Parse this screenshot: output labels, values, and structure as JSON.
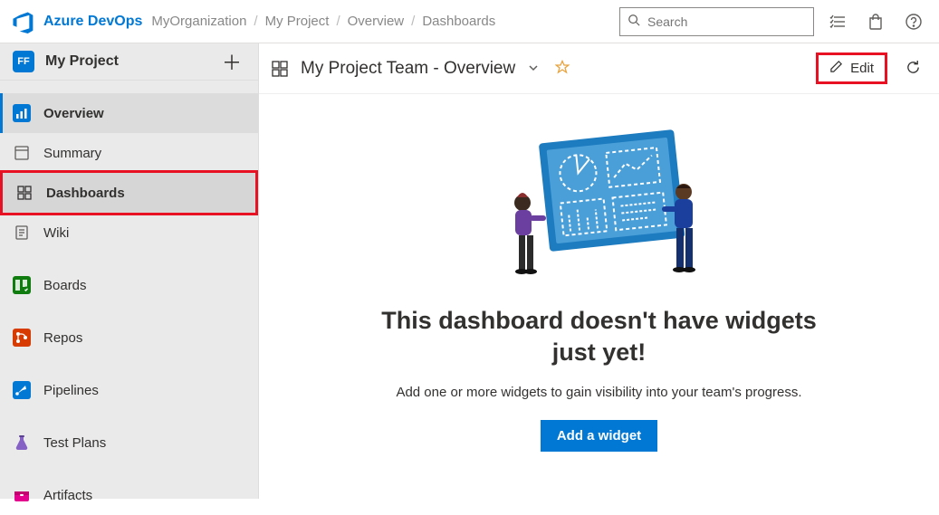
{
  "header": {
    "brand": "Azure DevOps",
    "breadcrumb": [
      "MyOrganization",
      "My Project",
      "Overview",
      "Dashboards"
    ],
    "search_placeholder": "Search"
  },
  "sidebar": {
    "project_badge": "FF",
    "project_name": "My Project",
    "items": [
      {
        "label": "Overview",
        "icon": "overview"
      },
      {
        "label": "Summary",
        "icon": "summary"
      },
      {
        "label": "Dashboards",
        "icon": "dashboards"
      },
      {
        "label": "Wiki",
        "icon": "wiki"
      },
      {
        "label": "Boards",
        "icon": "boards"
      },
      {
        "label": "Repos",
        "icon": "repos"
      },
      {
        "label": "Pipelines",
        "icon": "pipelines"
      },
      {
        "label": "Test Plans",
        "icon": "testplans"
      },
      {
        "label": "Artifacts",
        "icon": "artifacts"
      }
    ]
  },
  "page": {
    "title": "My Project Team - Overview",
    "edit_label": "Edit"
  },
  "empty_state": {
    "heading": "This dashboard doesn't have widgets just yet!",
    "subtext": "Add one or more widgets to gain visibility into your team's progress.",
    "button": "Add a widget"
  }
}
